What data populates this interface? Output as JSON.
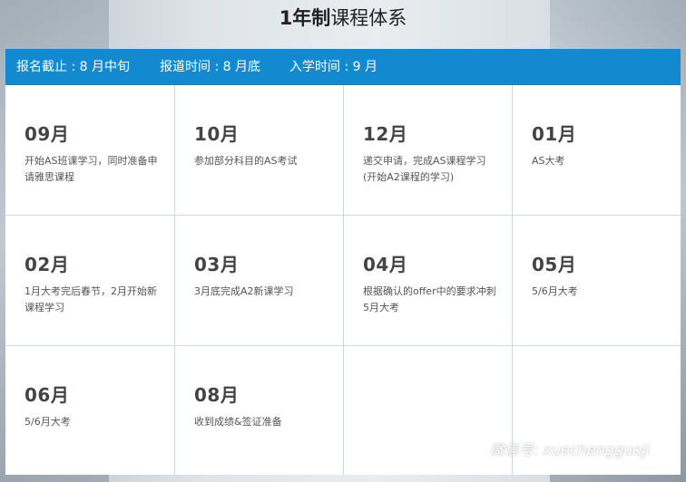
{
  "title": {
    "bold": "1年制",
    "rest": "课程体系"
  },
  "info_bar": [
    "报名截止 : 8 月中旬",
    "报道时间 : 8 月底",
    "入学时间 : 9 月"
  ],
  "months": [
    {
      "month": "09月",
      "desc": "开始AS班课学习，同时准备申请雅思课程"
    },
    {
      "month": "10月",
      "desc": "参加部分科目的AS考试"
    },
    {
      "month": "12月",
      "desc": "递交申请，完成AS课程学习(开始A2课程的学习)"
    },
    {
      "month": "01月",
      "desc": "AS大考"
    },
    {
      "month": "02月",
      "desc": "1月大考完后春节，2月开始新课程学习"
    },
    {
      "month": "03月",
      "desc": "3月底完成A2新课学习"
    },
    {
      "month": "04月",
      "desc": "根据确认的offer中的要求冲刺5月大考"
    },
    {
      "month": "05月",
      "desc": "5/6月大考"
    },
    {
      "month": "06月",
      "desc": "5/6月大考"
    },
    {
      "month": "08月",
      "desc": "收到成绩&签证准备"
    }
  ],
  "watermark": "微信号: xuechengguoji"
}
